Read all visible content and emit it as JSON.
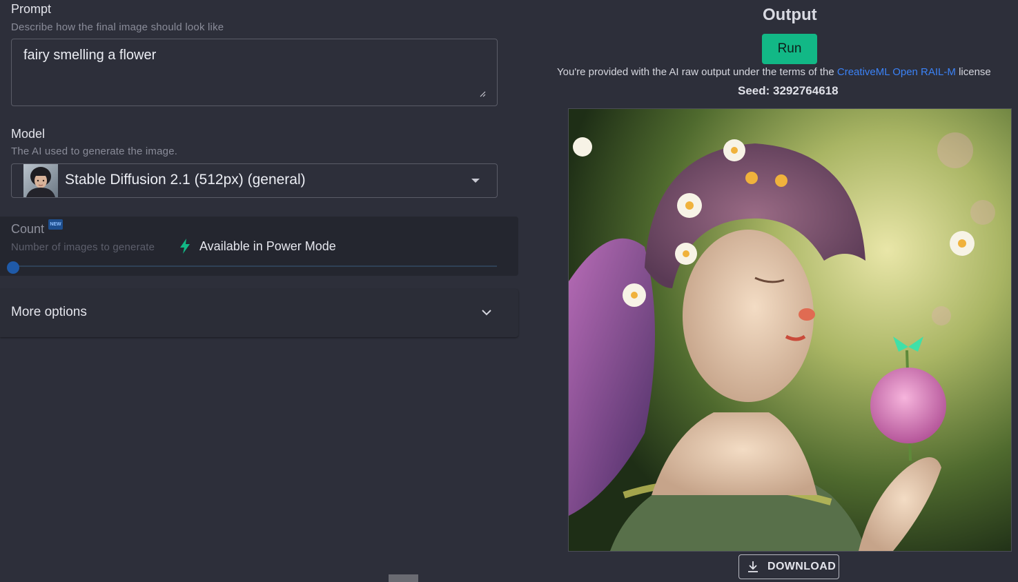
{
  "prompt": {
    "label": "Prompt",
    "description": "Describe how the final image should look like",
    "value": "fairy smelling a flower"
  },
  "model": {
    "label": "Model",
    "description": "The AI used to generate the image.",
    "selected": "Stable Diffusion 2.1 (512px) (general)"
  },
  "count": {
    "label": "Count",
    "badge": "NEW",
    "description": "Number of images to generate",
    "power_mode_text": "Available in Power Mode",
    "slider_level": 0
  },
  "more_options": {
    "label": "More options"
  },
  "output": {
    "title": "Output",
    "run_label": "Run",
    "license_prefix": "You're provided with the AI raw output under the terms of the",
    "license_link": "CreativeML Open RAIL-M",
    "license_suffix": "license",
    "seed_text": "Seed: 3292764618",
    "download_label": "DOWNLOAD"
  },
  "colors": {
    "accent_green": "#12b886",
    "link_blue": "#3b82f6",
    "background": "#2d2f3a",
    "panel_dark": "#24262f"
  },
  "icons": [
    "resize-handle-icon",
    "caret-down-icon",
    "new-badge",
    "bolt-icon",
    "chevron-down-icon",
    "download-icon"
  ]
}
